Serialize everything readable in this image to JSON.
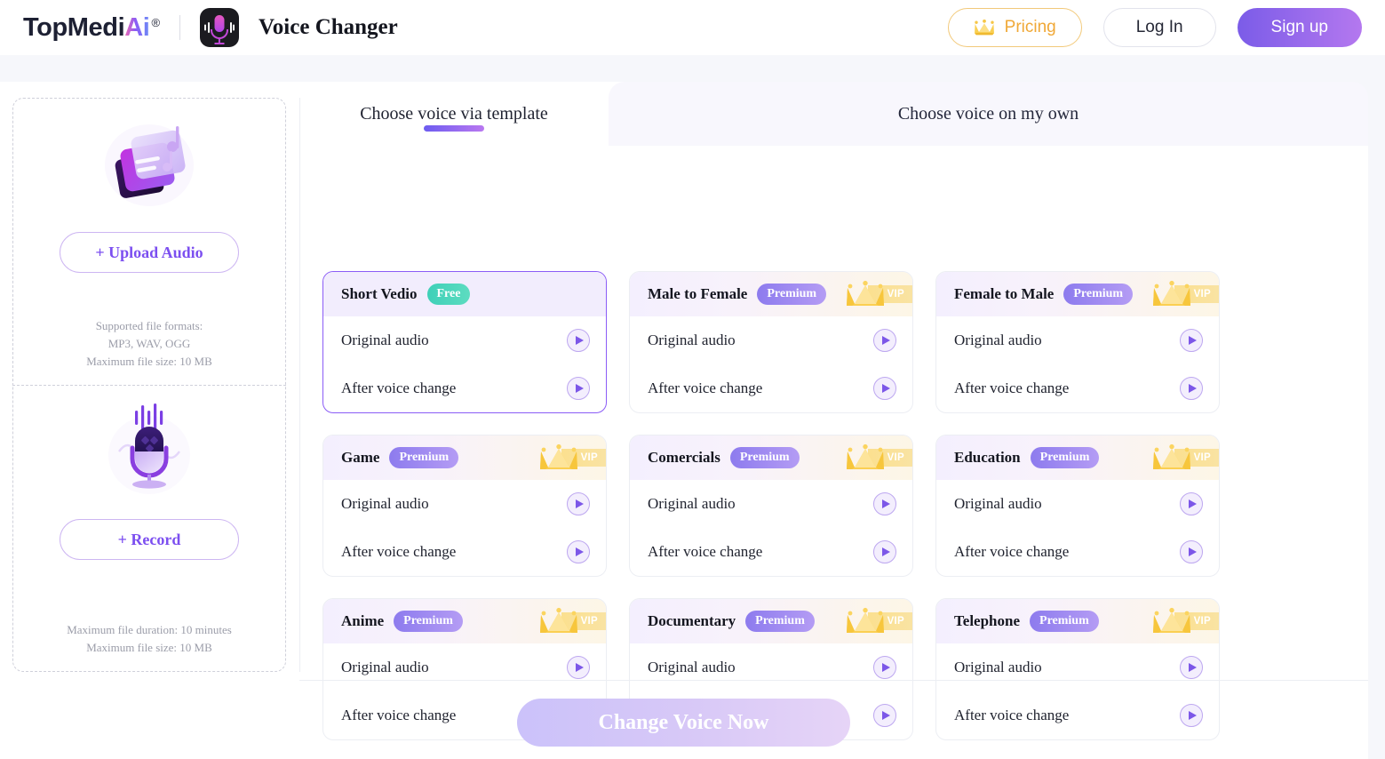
{
  "header": {
    "brand_main": "TopMedi",
    "brand_accent": "Ai",
    "brand_reg": "®",
    "app_icon": "microphone-icon",
    "page_title": "Voice Changer",
    "pricing_label": "Pricing",
    "pricing_icon": "crown-icon",
    "login_label": "Log In",
    "signup_label": "Sign up",
    "signup_gradient": "#7b5ce8"
  },
  "sidebar": {
    "upload": {
      "illustration": "audio-files-icon",
      "button_label": "+ Upload Audio",
      "hint_line1": "Supported file formats:",
      "hint_line2": "MP3, WAV, OGG",
      "hint_line3": "Maximum file size: 10 MB"
    },
    "record": {
      "illustration": "microphone-illustration-icon",
      "button_label": "+ Record",
      "hint_line1": "Maximum file duration: 10 minutes",
      "hint_line2": "Maximum file size: 10 MB"
    }
  },
  "tabs": [
    {
      "label": "Choose voice via template",
      "active": true
    },
    {
      "label": "Choose voice on my own",
      "active": false
    }
  ],
  "rows": {
    "original": "Original audio",
    "after": "After voice change"
  },
  "vip_label": "VIP",
  "cards": [
    {
      "title": "Short Vedio",
      "badge": "Free",
      "tier": "free",
      "vip": false,
      "selected": true
    },
    {
      "title": "Male to Female",
      "badge": "Premium",
      "tier": "premium",
      "vip": true,
      "selected": false
    },
    {
      "title": "Female to Male",
      "badge": "Premium",
      "tier": "premium",
      "vip": true,
      "selected": false
    },
    {
      "title": "Game",
      "badge": "Premium",
      "tier": "premium",
      "vip": true,
      "selected": false
    },
    {
      "title": "Comercials",
      "badge": "Premium",
      "tier": "premium",
      "vip": true,
      "selected": false
    },
    {
      "title": "Education",
      "badge": "Premium",
      "tier": "premium",
      "vip": true,
      "selected": false
    },
    {
      "title": "Anime",
      "badge": "Premium",
      "tier": "premium",
      "vip": true,
      "selected": false
    },
    {
      "title": "Documentary",
      "badge": "Premium",
      "tier": "premium",
      "vip": true,
      "selected": false
    },
    {
      "title": "Telephone",
      "badge": "Premium",
      "tier": "premium",
      "vip": true,
      "selected": false
    }
  ],
  "footer": {
    "cta_label": "Change Voice Now",
    "cta_enabled": false
  }
}
